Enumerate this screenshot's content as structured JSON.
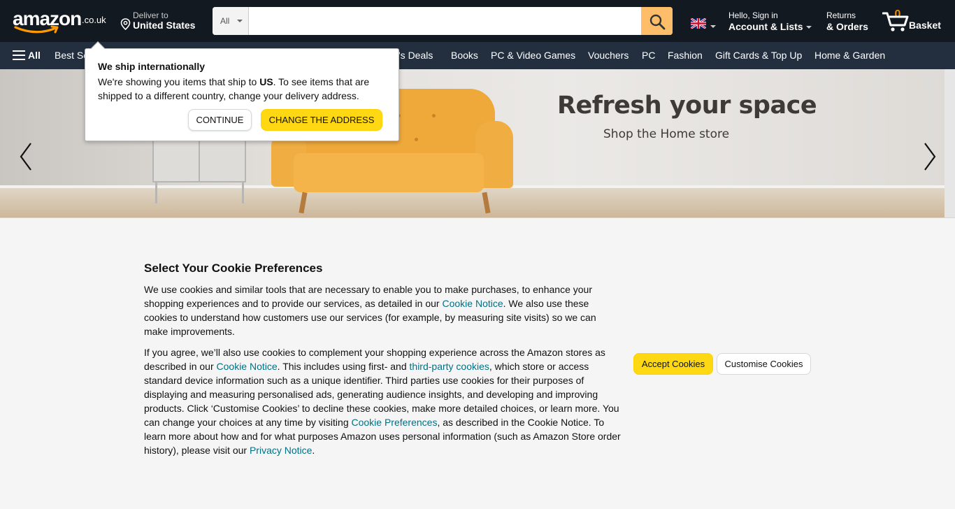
{
  "header": {
    "logo_text": "amazon",
    "logo_tld": ".co.uk",
    "deliver_label": "Deliver to",
    "deliver_country": "United States",
    "search_category": "All",
    "search_placeholder": "",
    "language_flag": "uk-flag-icon",
    "account_greeting": "Hello, Sign in",
    "account_label": "Account & Lists",
    "returns_label": "Returns",
    "orders_label": "& Orders",
    "basket_count": "0",
    "basket_label": "Basket"
  },
  "subnav": {
    "all_label": "All",
    "items": [
      "Best Se",
      "y's Deals",
      "Books",
      "PC & Video Games",
      "Vouchers",
      "PC",
      "Fashion",
      "Gift Cards & Top Up",
      "Home & Garden"
    ]
  },
  "hero": {
    "headline": "Refresh your space",
    "subline": "Shop the Home store"
  },
  "popover": {
    "title": "We ship internationally",
    "body_before": "We're showing you items that ship to ",
    "body_country": "US",
    "body_after": ". To see items that are shipped to a different country, change your delivery address.",
    "continue_label": "CONTINUE",
    "change_label": "CHANGE THE ADDRESS"
  },
  "cookie": {
    "title": "Select Your Cookie Preferences",
    "p1_a": "We use cookies and similar tools that are necessary to enable you to make purchases, to enhance your shopping experiences and to provide our services, as detailed in our ",
    "p1_link": "Cookie Notice",
    "p1_b": ". We also use these cookies to understand how customers use our services (for example, by measuring site visits) so we can make improvements.",
    "p2_a": "If you agree, we’ll also use cookies to complement your shopping experience across the Amazon stores as described in our ",
    "p2_link1": "Cookie Notice",
    "p2_b": ". This includes using first- and ",
    "p2_link2": "third-party cookies",
    "p2_c": ", which store or access standard device information such as a unique identifier. Third parties use cookies for their purposes of displaying and measuring personalised ads, generating audience insights, and developing and improving products. Click ‘Customise Cookies’ to decline these cookies, make more detailed choices, or learn more. You can change your choices at any time by visiting ",
    "p2_link3": "Cookie Preferences",
    "p2_d": ", as described in the Cookie Notice. To learn more about how and for what purposes Amazon uses personal information (such as Amazon Store order history), please visit our ",
    "p2_link4": "Privacy Notice",
    "p2_e": ".",
    "accept_label": "Accept Cookies",
    "customise_label": "Customise Cookies"
  },
  "colors": {
    "topbar": "#131921",
    "subnav": "#232f3e",
    "accent_yellow": "#ffd814",
    "search_button": "#febd69",
    "link": "#007185",
    "basket_count": "#f08804"
  }
}
